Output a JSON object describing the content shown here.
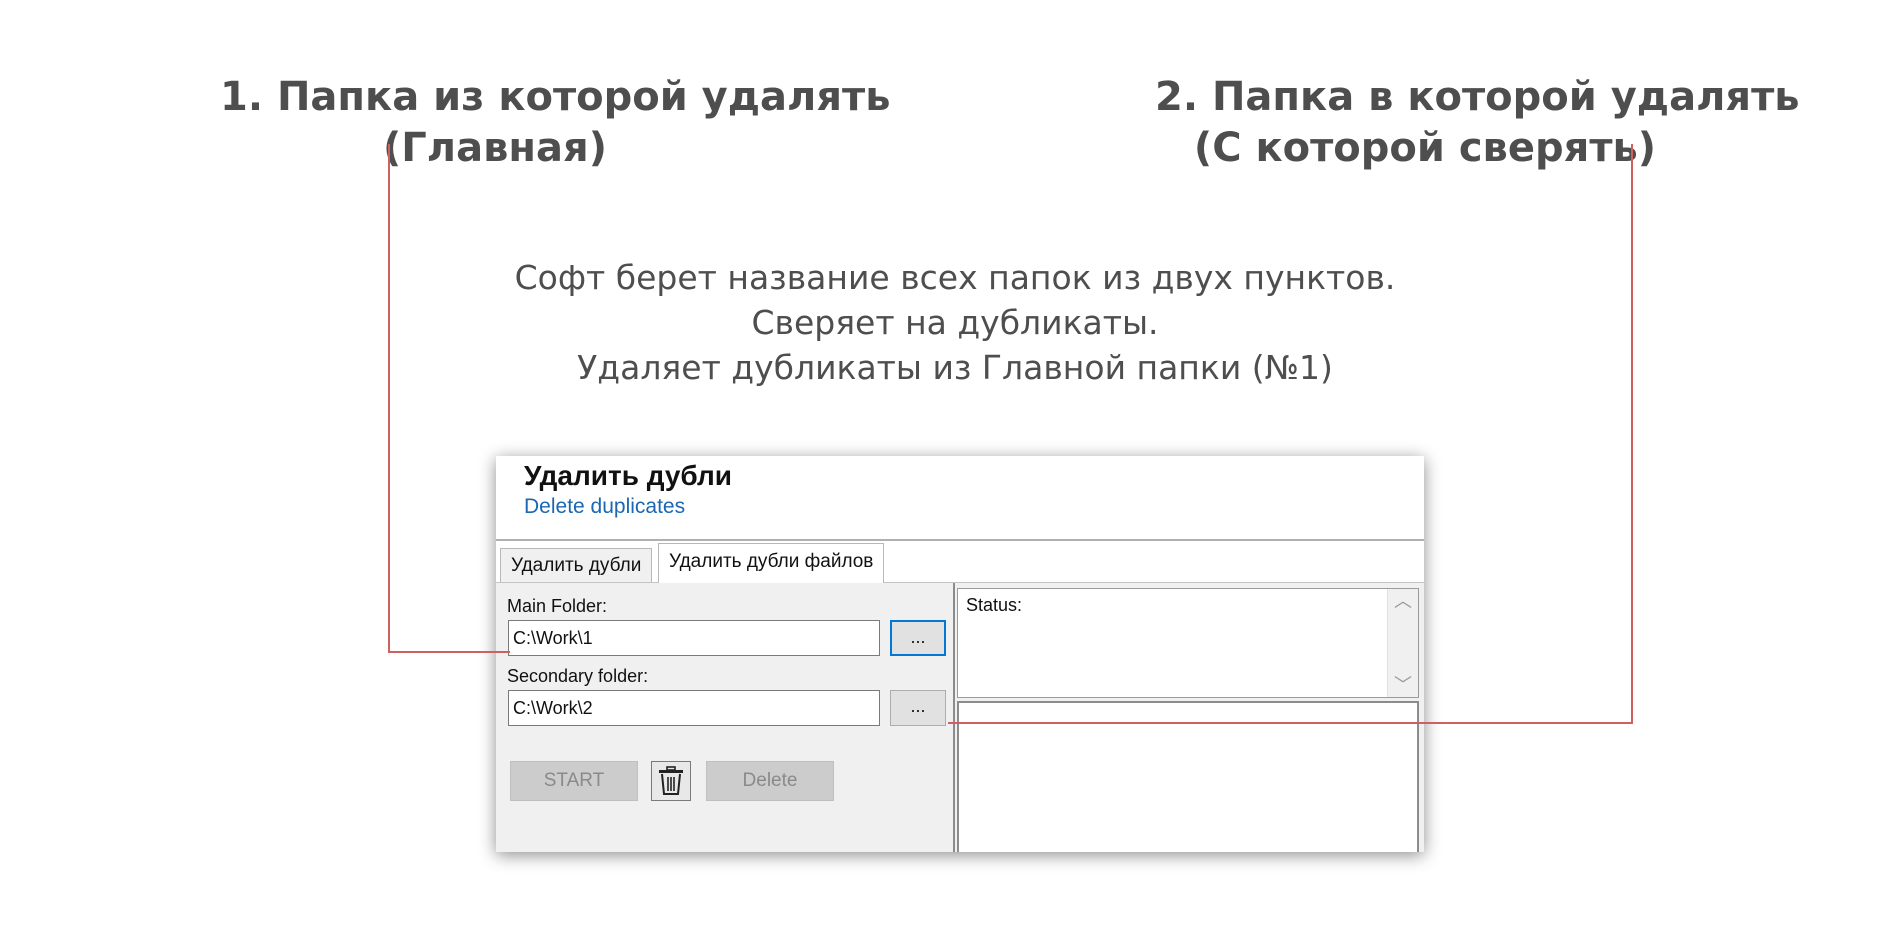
{
  "annotations": {
    "main_folder": [
      "1. Папка из которой удалять",
      "(Главная)"
    ],
    "secondary_folder": [
      "2. Папка в которой удалять",
      "(С которой сверять)"
    ]
  },
  "description": [
    "Софт берет название всех папок из двух пунктов.",
    "Сверяет на дубликаты.",
    "Удаляет дубликаты из Главной папки (№1)"
  ],
  "app": {
    "title": "Удалить дубли",
    "subtitle": "Delete duplicates",
    "tabs": [
      {
        "label": "Удалить дубли",
        "active": false
      },
      {
        "label": "Удалить дубли файлов",
        "active": true
      }
    ],
    "main_folder": {
      "label": "Main Folder:",
      "value": "C:\\Work\\1",
      "browse_label": "..."
    },
    "secondary_folder": {
      "label": "Secondary folder:",
      "value": "C:\\Work\\2",
      "browse_label": "..."
    },
    "buttons": {
      "start": "START",
      "trash_icon": "trash-icon",
      "delete": "Delete"
    },
    "status": {
      "label": "Status:"
    }
  },
  "colors": {
    "annotation_text": "#4e4e4e",
    "leader_line": "#d06060",
    "subtitle": "#1b67b3",
    "focus_border": "#0078d7"
  }
}
